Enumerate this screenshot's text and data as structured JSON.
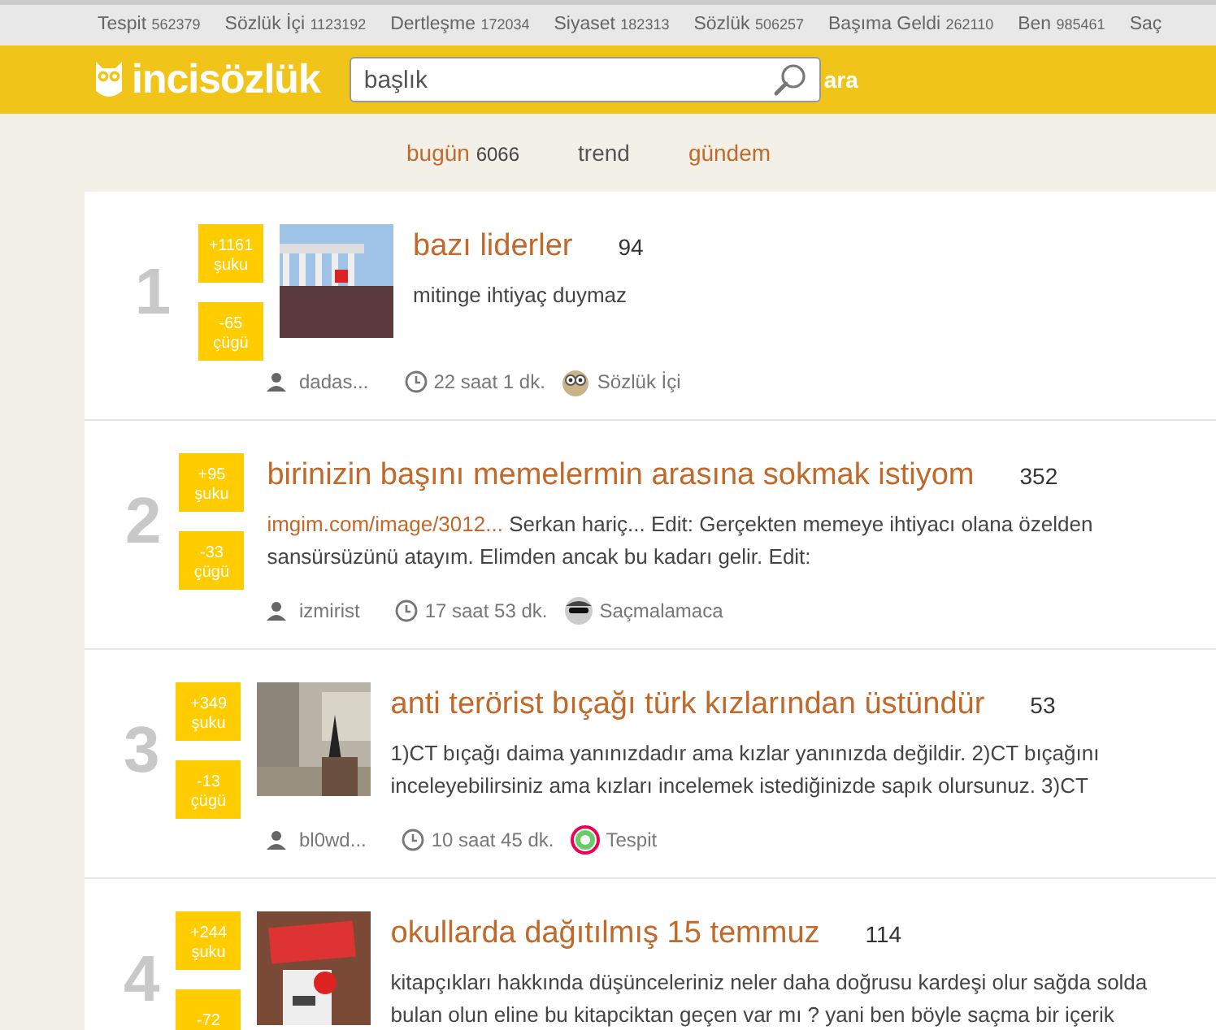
{
  "channels_bar": [
    {
      "name": "Tespit",
      "count": "562379"
    },
    {
      "name": "Sözlük İçi",
      "count": "1123192"
    },
    {
      "name": "Dertleşme",
      "count": "172034"
    },
    {
      "name": "Siyaset",
      "count": "182313"
    },
    {
      "name": "Sözlük",
      "count": "506257"
    },
    {
      "name": "Başıma Geldi",
      "count": "262110"
    },
    {
      "name": "Ben",
      "count": "985461"
    },
    {
      "name": "Saç"
    }
  ],
  "header": {
    "logo": "incisözlük",
    "search": {
      "value": "başlık"
    },
    "search_button": "ara"
  },
  "tabs": [
    {
      "label": "bugün",
      "count": "6066",
      "selected": false
    },
    {
      "label": "trend",
      "selected": true
    },
    {
      "label": "gündem",
      "selected": false
    }
  ],
  "entries": [
    {
      "rank": "1",
      "up": "+1161",
      "up_label": "şuku",
      "down": "-65",
      "down_label": "çügü",
      "title": "bazı liderler",
      "count": "94",
      "text": "mitinge ihtiyaç duymaz",
      "author": "dadas...",
      "time": "22 saat 1 dk.",
      "category": {
        "kind": "owl",
        "label": "Sözlük İçi"
      }
    },
    {
      "rank": "2",
      "up": "+95",
      "up_label": "şuku",
      "down": "-33",
      "down_label": "çügü",
      "title": "birinizin başını memelermin arasına sokmak istiyom",
      "count": "352",
      "link": "imgim.com/image/3012...",
      "text": "Serkan hariç... Edit: Gerçekten memeye ihtiyacı olana özelden sansürsüzünü atayım. Elimden ancak bu kadarı gelir. Edit:",
      "author": "izmirist",
      "time": "17 saat 53 dk.",
      "category": {
        "kind": "avatar",
        "label": "Saçmalamaca"
      }
    },
    {
      "rank": "3",
      "up": "+349",
      "up_label": "şuku",
      "down": "-13",
      "down_label": "çügü",
      "title": "anti terörist bıçağı türk kızlarından üstündür",
      "count": "53",
      "text": "1)CT bıçağı daima yanınızdadır ama kızlar yanınızda değildir. 2)CT bıçağını inceleyebilirsiniz ama kızları incelemek istediğinizde sapık olursunuz. 3)CT",
      "author": "bl0wd...",
      "time": "10 saat 45 dk.",
      "category": {
        "kind": "ring",
        "label": "Tespit"
      }
    },
    {
      "rank": "4",
      "up": "+244",
      "up_label": "şuku",
      "down": "-72",
      "title": "okullarda dağıtılmış 15 temmuz",
      "count": "114",
      "text": "kitapçıkları hakkında düşünceleriniz neler daha doğrusu kardeşi olur sağda solda bulan olun eline bu kitapciktan geçen var mı ? yani ben böyle saçma bir içerik"
    }
  ]
}
